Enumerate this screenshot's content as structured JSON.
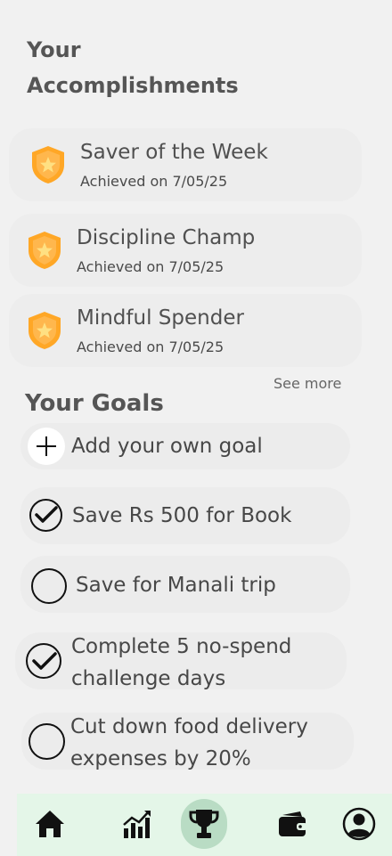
{
  "header": {
    "title": "Your Accomplishments"
  },
  "accomplishments": [
    {
      "title": "Saver of the Week",
      "date": "Achieved on 7/05/25",
      "icon": "badge-icon"
    },
    {
      "title": "Discipline Champ",
      "date": "Achieved on 7/05/25",
      "icon": "badge-icon"
    },
    {
      "title": "Mindful Spender",
      "date": "Achieved on 7/05/25",
      "icon": "badge-icon"
    }
  ],
  "see_more": "See more",
  "goals_section": {
    "title": "Your Goals",
    "add_label": "Add your own goal",
    "items": [
      {
        "line1": "Save Rs 500 for Book",
        "line2": "",
        "done": true
      },
      {
        "line1": "Save for Manali trip",
        "line2": "",
        "done": false
      },
      {
        "line1": "Complete 5 no-spend",
        "line2": "challenge days",
        "done": true
      },
      {
        "line1": "Cut down food delivery",
        "line2": "expenses by 20%",
        "done": false
      }
    ]
  },
  "nav": {
    "items": [
      {
        "name": "home-icon",
        "active": false
      },
      {
        "name": "chart-icon",
        "active": false
      },
      {
        "name": "trophy-icon",
        "active": true
      },
      {
        "name": "wallet-icon",
        "active": false
      },
      {
        "name": "profile-icon",
        "active": false
      }
    ]
  },
  "colors": {
    "badge": "#ffa726",
    "nav_bg": "#e4f6e8",
    "nav_active": "#b9dcc4"
  }
}
